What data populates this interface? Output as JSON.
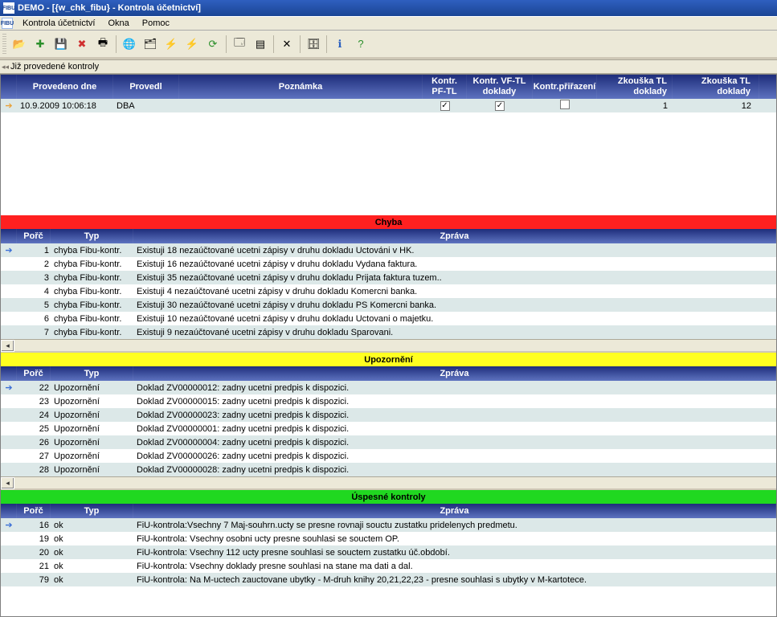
{
  "app_icon_text": "FIBU",
  "title": "DEMO - [{w_chk_fibu} - Kontrola účetnictví]",
  "menu": [
    "Kontrola účetnictví",
    "Okna",
    "Pomoc"
  ],
  "section_label": "Již provedené kontroly",
  "top_headers": {
    "date": "Provedeno dne",
    "user": "Provedl",
    "note": "Poznámka",
    "k1": "Kontr. PF-TL",
    "k2": "Kontr. VF-TL doklady",
    "k3": "Kontr.přiřazení",
    "z1": "Zkouška TL doklady",
    "z2": "Zkouška TL doklady"
  },
  "top_row": {
    "date": "10.9.2009 10:06:18",
    "user": "DBA",
    "note": "",
    "k1": true,
    "k2": true,
    "k3": false,
    "z1": "1",
    "z2": "12"
  },
  "err_banner": "Chyba",
  "err_headers": {
    "porc": "Pořč",
    "typ": "Typ",
    "msg": "Zpráva"
  },
  "errors": [
    {
      "n": "1",
      "t": "chyba Fibu-kontr.",
      "m": "Existuji 18 nezaúčtované ucetni zápisy v druhu dokladu Uctováni v HK."
    },
    {
      "n": "2",
      "t": "chyba Fibu-kontr.",
      "m": "Existuji 16 nezaúčtované ucetni zápisy v druhu dokladu Vydana faktura."
    },
    {
      "n": "3",
      "t": "chyba Fibu-kontr.",
      "m": "Existuji 35 nezaúčtované ucetni zápisy v druhu dokladu Prijata faktura tuzem.."
    },
    {
      "n": "4",
      "t": "chyba Fibu-kontr.",
      "m": "Existuji 4 nezaúčtované ucetni zápisy v druhu dokladu Komercni banka."
    },
    {
      "n": "5",
      "t": "chyba Fibu-kontr.",
      "m": "Existuji 30 nezaúčtované ucetni zápisy v druhu dokladu PS Komercni banka."
    },
    {
      "n": "6",
      "t": "chyba Fibu-kontr.",
      "m": "Existuji 10 nezaúčtované ucetni zápisy v druhu dokladu Uctovani o majetku."
    },
    {
      "n": "7",
      "t": "chyba Fibu-kontr.",
      "m": "Existuji 9 nezaúčtované ucetni zápisy v druhu dokladu Sparovani."
    }
  ],
  "warn_banner": "Upozornění",
  "warn_headers": {
    "porc": "Pořč",
    "typ": "Typ",
    "msg": "Zpráva"
  },
  "warnings": [
    {
      "n": "22",
      "t": "Upozornění",
      "m": "Doklad ZV00000012: zadny ucetni predpis k dispozici."
    },
    {
      "n": "23",
      "t": "Upozornění",
      "m": "Doklad ZV00000015: zadny ucetni predpis k dispozici."
    },
    {
      "n": "24",
      "t": "Upozornění",
      "m": "Doklad ZV00000023: zadny ucetni predpis k dispozici."
    },
    {
      "n": "25",
      "t": "Upozornění",
      "m": "Doklad ZV00000001: zadny ucetni predpis k dispozici."
    },
    {
      "n": "26",
      "t": "Upozornění",
      "m": "Doklad ZV00000004: zadny ucetni predpis k dispozici."
    },
    {
      "n": "27",
      "t": "Upozornění",
      "m": "Doklad ZV00000026: zadny ucetni predpis k dispozici."
    },
    {
      "n": "28",
      "t": "Upozornění",
      "m": "Doklad ZV00000028: zadny ucetni predpis k dispozici."
    }
  ],
  "ok_banner": "Úspesné kontroly",
  "ok_headers": {
    "porc": "Pořč",
    "typ": "Typ",
    "msg": "Zpráva"
  },
  "oks": [
    {
      "n": "16",
      "t": "ok",
      "m": "FiU-kontrola:Vsechny 7 Maj-souhrn.ucty se presne rovnaji souctu zustatku pridelenych predmetu."
    },
    {
      "n": "19",
      "t": "ok",
      "m": "FiU-kontrola: Vsechny osobni ucty presne souhlasi se souctem OP."
    },
    {
      "n": "20",
      "t": "ok",
      "m": "FiU-kontrola: Vsechny 112 ucty presne souhlasi se souctem zustatku úč.období."
    },
    {
      "n": "21",
      "t": "ok",
      "m": "FiU-kontrola: Vsechny doklady presne souhlasi na stane ma dati a dal."
    },
    {
      "n": "79",
      "t": "ok",
      "m": "FiU-kontrola: Na M-uctech zauctovane ubytky - M-druh knihy 20,21,22,23 - presne souhlasi s ubytky v M-kartotece."
    }
  ]
}
